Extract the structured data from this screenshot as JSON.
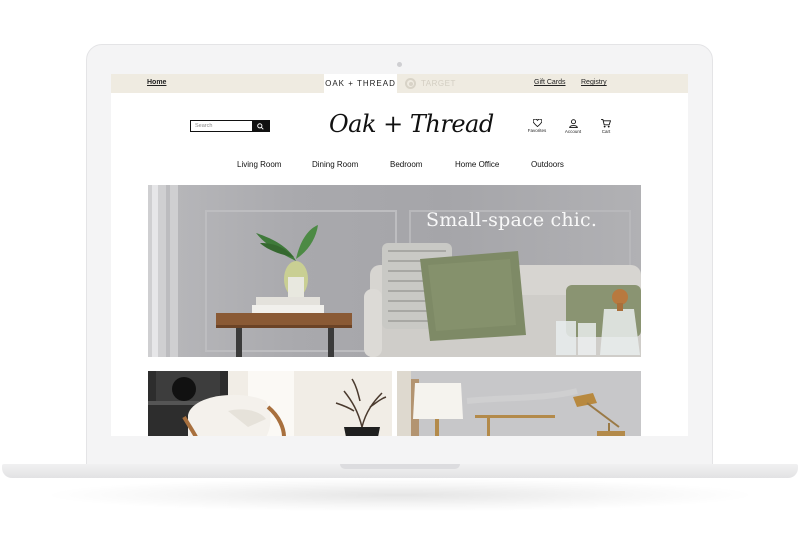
{
  "topbar": {
    "home_label": "Home",
    "brand_tab": "OAK + THREAD",
    "target_tab": "TARGET",
    "gift_cards_label": "Gift Cards",
    "registry_label": "Registry"
  },
  "header": {
    "logo_text": "Oak + Thread",
    "search": {
      "placeholder": "Search"
    },
    "icons": {
      "favorites_label": "Favorites",
      "account_label": "Account",
      "cart_label": "Cart"
    }
  },
  "nav": {
    "items": [
      {
        "label": "Living Room"
      },
      {
        "label": "Dining Room"
      },
      {
        "label": "Bedroom"
      },
      {
        "label": "Home Office"
      },
      {
        "label": "Outdoors"
      }
    ]
  },
  "hero": {
    "headline": "Small-space chic."
  },
  "icon_names": [
    "search-icon",
    "heart-icon",
    "user-icon",
    "cart-icon",
    "target-icon"
  ],
  "colors": {
    "utility_bar": "#efebe1",
    "hero_wall": "#a9a9ad",
    "pillow_green": "#7e8a66",
    "table_wood": "#8a5a35"
  }
}
